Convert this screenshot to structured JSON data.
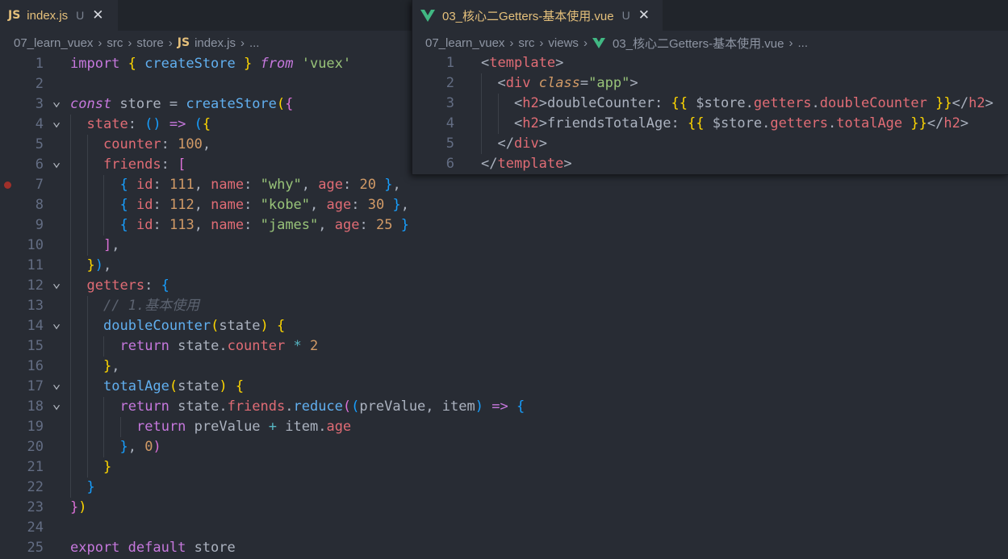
{
  "left_editor": {
    "tab": {
      "badge": "JS",
      "name": "index.js",
      "status": "U",
      "close": "✕"
    },
    "breadcrumb": [
      "07_learn_vuex",
      "src",
      "store"
    ],
    "breadcrumb_file": "index.js",
    "breadcrumb_badge": "JS",
    "breadcrumb_more": "...",
    "lines": [
      {
        "n": "1",
        "fold": false,
        "bp": false,
        "indent": 0,
        "tokens": [
          [
            "kw",
            "import"
          ],
          [
            "pl",
            " "
          ],
          [
            "b1",
            "{"
          ],
          [
            "pl",
            " "
          ],
          [
            "fn",
            "createStore"
          ],
          [
            "pl",
            " "
          ],
          [
            "b1",
            "}"
          ],
          [
            "pl",
            " "
          ],
          [
            "kwi",
            "from"
          ],
          [
            "pl",
            " "
          ],
          [
            "str",
            "'vuex'"
          ]
        ]
      },
      {
        "n": "2",
        "fold": false,
        "bp": false,
        "indent": 0,
        "tokens": []
      },
      {
        "n": "3",
        "fold": true,
        "bp": false,
        "indent": 0,
        "tokens": [
          [
            "kwi",
            "const"
          ],
          [
            "pl",
            " store = "
          ],
          [
            "fn",
            "createStore"
          ],
          [
            "b1",
            "("
          ],
          [
            "b2",
            "{"
          ]
        ]
      },
      {
        "n": "4",
        "fold": true,
        "bp": false,
        "indent": 1,
        "tokens": [
          [
            "prop",
            "state"
          ],
          [
            "pl",
            ": "
          ],
          [
            "b3",
            "()"
          ],
          [
            "pl",
            " "
          ],
          [
            "kw",
            "=>"
          ],
          [
            "pl",
            " "
          ],
          [
            "b3",
            "("
          ],
          [
            "b1",
            "{"
          ]
        ]
      },
      {
        "n": "5",
        "fold": false,
        "bp": false,
        "indent": 2,
        "tokens": [
          [
            "prop",
            "counter"
          ],
          [
            "pl",
            ": "
          ],
          [
            "num",
            "100"
          ],
          [
            "pl",
            ","
          ]
        ]
      },
      {
        "n": "6",
        "fold": true,
        "bp": false,
        "indent": 2,
        "tokens": [
          [
            "prop",
            "friends"
          ],
          [
            "pl",
            ": "
          ],
          [
            "b2",
            "["
          ]
        ]
      },
      {
        "n": "7",
        "fold": false,
        "bp": true,
        "indent": 3,
        "tokens": [
          [
            "b3",
            "{"
          ],
          [
            "pl",
            " "
          ],
          [
            "prop",
            "id"
          ],
          [
            "pl",
            ": "
          ],
          [
            "num",
            "111"
          ],
          [
            "pl",
            ", "
          ],
          [
            "prop",
            "name"
          ],
          [
            "pl",
            ": "
          ],
          [
            "str",
            "\"why\""
          ],
          [
            "pl",
            ", "
          ],
          [
            "prop",
            "age"
          ],
          [
            "pl",
            ": "
          ],
          [
            "num",
            "20"
          ],
          [
            "pl",
            " "
          ],
          [
            "b3",
            "}"
          ],
          [
            "pl",
            ","
          ]
        ]
      },
      {
        "n": "8",
        "fold": false,
        "bp": false,
        "indent": 3,
        "tokens": [
          [
            "b3",
            "{"
          ],
          [
            "pl",
            " "
          ],
          [
            "prop",
            "id"
          ],
          [
            "pl",
            ": "
          ],
          [
            "num",
            "112"
          ],
          [
            "pl",
            ", "
          ],
          [
            "prop",
            "name"
          ],
          [
            "pl",
            ": "
          ],
          [
            "str",
            "\"kobe\""
          ],
          [
            "pl",
            ", "
          ],
          [
            "prop",
            "age"
          ],
          [
            "pl",
            ": "
          ],
          [
            "num",
            "30"
          ],
          [
            "pl",
            " "
          ],
          [
            "b3",
            "}"
          ],
          [
            "pl",
            ","
          ]
        ]
      },
      {
        "n": "9",
        "fold": false,
        "bp": false,
        "indent": 3,
        "tokens": [
          [
            "b3",
            "{"
          ],
          [
            "pl",
            " "
          ],
          [
            "prop",
            "id"
          ],
          [
            "pl",
            ": "
          ],
          [
            "num",
            "113"
          ],
          [
            "pl",
            ", "
          ],
          [
            "prop",
            "name"
          ],
          [
            "pl",
            ": "
          ],
          [
            "str",
            "\"james\""
          ],
          [
            "pl",
            ", "
          ],
          [
            "prop",
            "age"
          ],
          [
            "pl",
            ": "
          ],
          [
            "num",
            "25"
          ],
          [
            "pl",
            " "
          ],
          [
            "b3",
            "}"
          ]
        ]
      },
      {
        "n": "10",
        "fold": false,
        "bp": false,
        "indent": 2,
        "tokens": [
          [
            "b2",
            "]"
          ],
          [
            "pl",
            ","
          ]
        ]
      },
      {
        "n": "11",
        "fold": false,
        "bp": false,
        "indent": 1,
        "tokens": [
          [
            "b1",
            "}"
          ],
          [
            "b3",
            ")"
          ],
          [
            "pl",
            ","
          ]
        ]
      },
      {
        "n": "12",
        "fold": true,
        "bp": false,
        "indent": 1,
        "tokens": [
          [
            "prop",
            "getters"
          ],
          [
            "pl",
            ": "
          ],
          [
            "b3",
            "{"
          ]
        ]
      },
      {
        "n": "13",
        "fold": false,
        "bp": false,
        "indent": 2,
        "tokens": [
          [
            "cm",
            "// 1.基本使用"
          ]
        ]
      },
      {
        "n": "14",
        "fold": true,
        "bp": false,
        "indent": 2,
        "tokens": [
          [
            "fn",
            "doubleCounter"
          ],
          [
            "b1",
            "("
          ],
          [
            "pl",
            "state"
          ],
          [
            "b1",
            ")"
          ],
          [
            "pl",
            " "
          ],
          [
            "b1",
            "{"
          ]
        ]
      },
      {
        "n": "15",
        "fold": false,
        "bp": false,
        "indent": 3,
        "tokens": [
          [
            "kw",
            "return"
          ],
          [
            "pl",
            " state."
          ],
          [
            "prop",
            "counter"
          ],
          [
            "pl",
            " "
          ],
          [
            "op",
            "*"
          ],
          [
            "pl",
            " "
          ],
          [
            "num",
            "2"
          ]
        ]
      },
      {
        "n": "16",
        "fold": false,
        "bp": false,
        "indent": 2,
        "tokens": [
          [
            "b1",
            "}"
          ],
          [
            "pl",
            ","
          ]
        ]
      },
      {
        "n": "17",
        "fold": true,
        "bp": false,
        "indent": 2,
        "tokens": [
          [
            "fn",
            "totalAge"
          ],
          [
            "b1",
            "("
          ],
          [
            "pl",
            "state"
          ],
          [
            "b1",
            ")"
          ],
          [
            "pl",
            " "
          ],
          [
            "b1",
            "{"
          ]
        ]
      },
      {
        "n": "18",
        "fold": true,
        "bp": false,
        "indent": 3,
        "tokens": [
          [
            "kw",
            "return"
          ],
          [
            "pl",
            " state."
          ],
          [
            "prop",
            "friends"
          ],
          [
            "pl",
            "."
          ],
          [
            "fn",
            "reduce"
          ],
          [
            "b2",
            "("
          ],
          [
            "b3",
            "("
          ],
          [
            "pl",
            "preValue"
          ],
          [
            "pl",
            ", "
          ],
          [
            "pl",
            "item"
          ],
          [
            "b3",
            ")"
          ],
          [
            "pl",
            " "
          ],
          [
            "kw",
            "=>"
          ],
          [
            "pl",
            " "
          ],
          [
            "b3",
            "{"
          ]
        ]
      },
      {
        "n": "19",
        "fold": false,
        "bp": false,
        "indent": 4,
        "tokens": [
          [
            "kw",
            "return"
          ],
          [
            "pl",
            " preValue "
          ],
          [
            "op",
            "+"
          ],
          [
            "pl",
            " item."
          ],
          [
            "prop",
            "age"
          ]
        ]
      },
      {
        "n": "20",
        "fold": false,
        "bp": false,
        "indent": 3,
        "tokens": [
          [
            "b3",
            "}"
          ],
          [
            "pl",
            ", "
          ],
          [
            "num",
            "0"
          ],
          [
            "b2",
            ")"
          ]
        ]
      },
      {
        "n": "21",
        "fold": false,
        "bp": false,
        "indent": 2,
        "tokens": [
          [
            "b1",
            "}"
          ]
        ]
      },
      {
        "n": "22",
        "fold": false,
        "bp": false,
        "indent": 1,
        "tokens": [
          [
            "b3",
            "}"
          ]
        ]
      },
      {
        "n": "23",
        "fold": false,
        "bp": false,
        "indent": 0,
        "tokens": [
          [
            "b2",
            "}"
          ],
          [
            "b1",
            ")"
          ]
        ]
      },
      {
        "n": "24",
        "fold": false,
        "bp": false,
        "indent": 0,
        "tokens": []
      },
      {
        "n": "25",
        "fold": false,
        "bp": false,
        "indent": 0,
        "tokens": [
          [
            "kw",
            "export"
          ],
          [
            "pl",
            " "
          ],
          [
            "kw",
            "default"
          ],
          [
            "pl",
            " store"
          ]
        ]
      }
    ]
  },
  "right_editor": {
    "tab": {
      "name": "03_核心二Getters-基本使用.vue",
      "status": "U",
      "close": "✕"
    },
    "breadcrumb": [
      "07_learn_vuex",
      "src",
      "views"
    ],
    "breadcrumb_file": "03_核心二Getters-基本使用.vue",
    "breadcrumb_more": "...",
    "lines": [
      {
        "n": "1",
        "indent": 0,
        "tokens": [
          [
            "punc",
            "<"
          ],
          [
            "tag",
            "template"
          ],
          [
            "punc",
            ">"
          ]
        ]
      },
      {
        "n": "2",
        "indent": 1,
        "tokens": [
          [
            "punc",
            "<"
          ],
          [
            "tag",
            "div"
          ],
          [
            "pl",
            " "
          ],
          [
            "attr",
            "class"
          ],
          [
            "punc",
            "="
          ],
          [
            "str",
            "\"app\""
          ],
          [
            "punc",
            ">"
          ]
        ]
      },
      {
        "n": "3",
        "indent": 2,
        "tokens": [
          [
            "punc",
            "<"
          ],
          [
            "tag",
            "h2"
          ],
          [
            "punc",
            ">"
          ],
          [
            "pl",
            "doubleCounter: "
          ],
          [
            "b1",
            "{{"
          ],
          [
            "pl",
            " $store."
          ],
          [
            "prop",
            "getters"
          ],
          [
            "pl",
            "."
          ],
          [
            "prop",
            "doubleCounter"
          ],
          [
            "pl",
            " "
          ],
          [
            "b1",
            "}}"
          ],
          [
            "punc",
            "</"
          ],
          [
            "tag",
            "h2"
          ],
          [
            "punc",
            ">"
          ]
        ]
      },
      {
        "n": "4",
        "indent": 2,
        "tokens": [
          [
            "punc",
            "<"
          ],
          [
            "tag",
            "h2"
          ],
          [
            "punc",
            ">"
          ],
          [
            "pl",
            "friendsTotalAge: "
          ],
          [
            "b1",
            "{{"
          ],
          [
            "pl",
            " $store."
          ],
          [
            "prop",
            "getters"
          ],
          [
            "pl",
            "."
          ],
          [
            "prop",
            "totalAge"
          ],
          [
            "pl",
            " "
          ],
          [
            "b1",
            "}}"
          ],
          [
            "punc",
            "</"
          ],
          [
            "tag",
            "h2"
          ],
          [
            "punc",
            ">"
          ]
        ]
      },
      {
        "n": "5",
        "indent": 1,
        "tokens": [
          [
            "punc",
            "</"
          ],
          [
            "tag",
            "div"
          ],
          [
            "punc",
            ">"
          ]
        ]
      },
      {
        "n": "6",
        "indent": 0,
        "tokens": [
          [
            "punc",
            "</"
          ],
          [
            "tag",
            "template"
          ],
          [
            "punc",
            ">"
          ]
        ]
      }
    ]
  }
}
